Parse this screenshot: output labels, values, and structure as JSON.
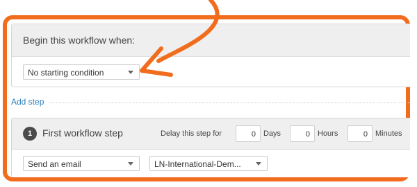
{
  "trigger": {
    "heading": "Begin this workflow when:",
    "condition_select": "No starting condition"
  },
  "add_step": {
    "label": "Add step"
  },
  "step": {
    "number": "1",
    "title": "First workflow step",
    "delay_label": "Delay this step for",
    "days_value": "0",
    "days_label": "Days",
    "hours_value": "0",
    "hours_label": "Hours",
    "minutes_value": "0",
    "minutes_label": "Minutes",
    "action_select": "Send an email",
    "email_select": "LN-International-Dem..."
  },
  "colors": {
    "highlight": "#f26c1d",
    "link": "#2a7dbb",
    "header_bg": "#efefef"
  },
  "icons": [
    "chevron-down-icon",
    "curved-arrow-icon"
  ]
}
